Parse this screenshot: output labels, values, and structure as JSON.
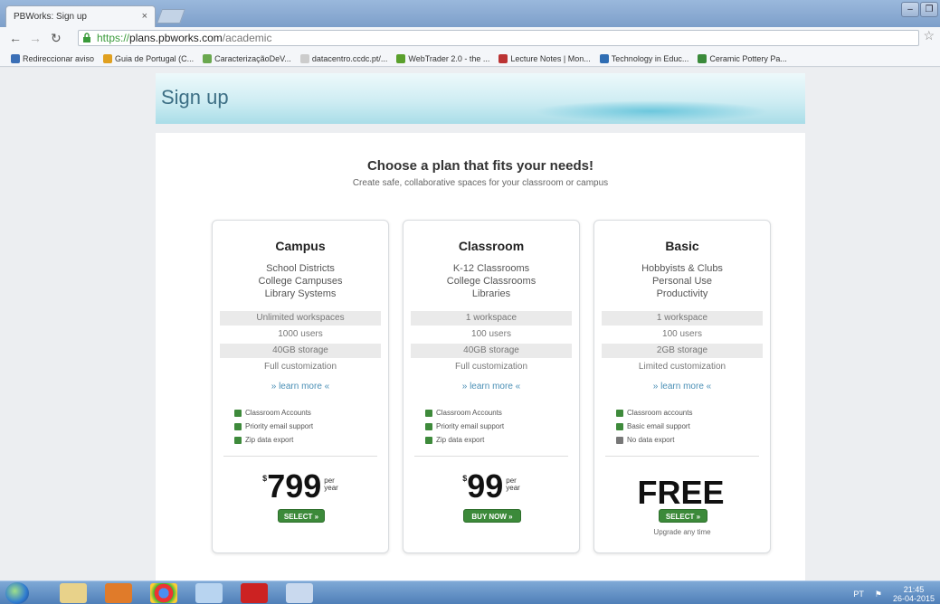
{
  "browser": {
    "tab_title": "PBWorks: Sign up",
    "tab_close": "×",
    "url_scheme": "https://",
    "url_host": "plans.pbworks.com",
    "url_path": "/academic",
    "bookmarks": [
      {
        "label": "Redireccionar aviso",
        "color": "#3b6fb6"
      },
      {
        "label": "Guia de Portugal (C...",
        "color": "#e0a020"
      },
      {
        "label": "CaracterizaçãoDeV...",
        "color": "#6aa84f"
      },
      {
        "label": "datacentro.ccdc.pt/...",
        "color": "#cccccc"
      },
      {
        "label": "WebTrader 2.0 - the ...",
        "color": "#5aa02c"
      },
      {
        "label": "Lecture Notes | Mon...",
        "color": "#b33"
      },
      {
        "label": "Technology in Educ...",
        "color": "#2f6db3"
      },
      {
        "label": "Ceramic Pottery Pa...",
        "color": "#3a8a3a"
      }
    ]
  },
  "page": {
    "title": "Sign up",
    "headline": "Choose a plan that fits your needs!",
    "subline": "Create safe, collaborative spaces for your classroom or campus",
    "learn_more": "» learn more «"
  },
  "plans": [
    {
      "name": "Campus",
      "audience": [
        "School Districts",
        "College Campuses",
        "Library Systems"
      ],
      "features": [
        "Unlimited workspaces",
        "1000 users",
        "40GB storage",
        "Full customization"
      ],
      "checks": [
        {
          "label": "Classroom Accounts",
          "on": true
        },
        {
          "label": "Priority email support",
          "on": true
        },
        {
          "label": "Zip data export",
          "on": true
        }
      ],
      "price_symbol": "$",
      "price": "799",
      "per": "per",
      "year": "year",
      "button": "SELECT »",
      "note": ""
    },
    {
      "name": "Classroom",
      "audience": [
        "K-12 Classrooms",
        "College Classrooms",
        "Libraries"
      ],
      "features": [
        "1 workspace",
        "100 users",
        "40GB storage",
        "Full customization"
      ],
      "checks": [
        {
          "label": "Classroom Accounts",
          "on": true
        },
        {
          "label": "Priority email support",
          "on": true
        },
        {
          "label": "Zip data export",
          "on": true
        }
      ],
      "price_symbol": "$",
      "price": "99",
      "per": "per",
      "year": "year",
      "button": "BUY NOW »",
      "note": ""
    },
    {
      "name": "Basic",
      "audience": [
        "Hobbyists & Clubs",
        "Personal Use",
        "Productivity"
      ],
      "features": [
        "1 workspace",
        "100 users",
        "2GB storage",
        "Limited customization"
      ],
      "checks": [
        {
          "label": "Classroom accounts",
          "on": true
        },
        {
          "label": "Basic email support",
          "on": true
        },
        {
          "label": "No data export",
          "on": false
        }
      ],
      "price_symbol": "",
      "price": "FREE",
      "per": "",
      "year": "",
      "button": "SELECT »",
      "note": "Upgrade any time"
    }
  ],
  "taskbar": {
    "tray_lang": "PT",
    "clock_time": "21:45",
    "clock_date": "26-04-2015"
  },
  "colors": {
    "select_button": "#3c8a3a",
    "header_accent": "#a9dde8",
    "title_text": "#3d6f85",
    "link": "#4a8fb5"
  }
}
